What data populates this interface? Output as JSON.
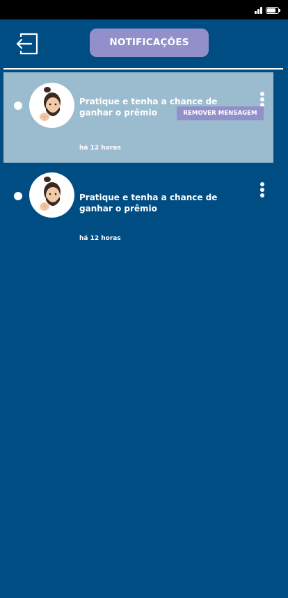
{
  "header": {
    "title": "NOTIFICAÇÕES",
    "back_icon": "logout-arrow-icon"
  },
  "notifications": [
    {
      "message": "Pratique e tenha a chance de ganhar o prêmio",
      "time": "há 12 horas",
      "unread": true,
      "selected": true,
      "menu_open": true
    },
    {
      "message": "Pratique e tenha a chance de ganhar o prêmio",
      "time": "há 12 horas",
      "unread": true,
      "selected": false,
      "menu_open": false
    }
  ],
  "context_menu": {
    "remove_label": "REMOVER MENSAGEM"
  },
  "colors": {
    "background": "#004d84",
    "accent": "#928fcb",
    "selected_card": "#9bbccf"
  }
}
